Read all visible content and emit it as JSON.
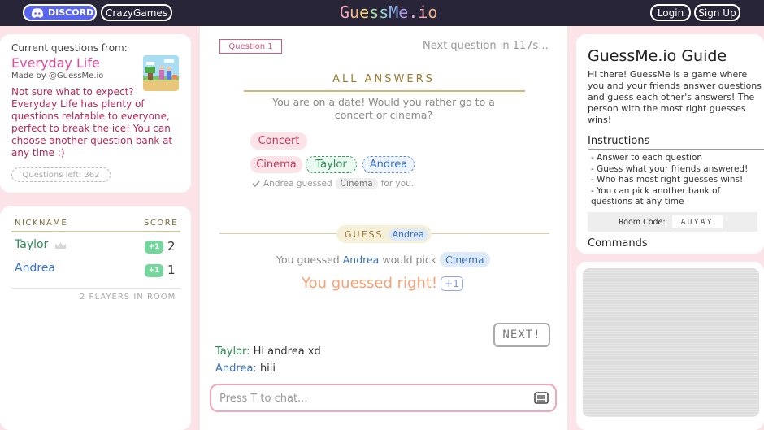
{
  "topbar": {
    "discord_label": "DISCORD",
    "crazy_label": "CrazyGames",
    "logo_letters": [
      "G",
      "u",
      "e",
      "s",
      "s",
      "M",
      "e",
      ".",
      "i",
      "o"
    ],
    "logo_colors": [
      "#f6a9b8",
      "#f3b48c",
      "#f7d57a",
      "#a7e0a3",
      "#8fd4d2",
      "#8fb3ef",
      "#b49cf0",
      "#e9a7e0",
      "#f6a9b8",
      "#f3b48c"
    ],
    "login_label": "Login",
    "signup_label": "Sign Up"
  },
  "current_questions": {
    "from_label": "Current questions from:",
    "name": "Everyday Life",
    "made_by": "Made by @GuessMe.io",
    "description": "Not sure what to expect? Everyday Life has plenty of questions relatable to everyone, perfect to break the ice! You can choose another question bank at any time :)",
    "questions_left": "Questions left: 362"
  },
  "players": {
    "nickname_header": "NICKNAME",
    "score_header": "SCORE",
    "list": [
      {
        "name": "Taylor",
        "badge": "+1",
        "score": "2",
        "color": "#2e8a55"
      },
      {
        "name": "Andrea",
        "badge": "+1",
        "score": "1",
        "color": "#3a6fc6"
      }
    ],
    "room_count": "2 PLAYERS IN ROOM"
  },
  "question": {
    "tag": "Question 1",
    "next_in": "Next question in 117s...",
    "all_answers_title": "ALL ANSWERS",
    "text": "You are on a date! Would you rather go to a concert or cinema?",
    "answers": {
      "concert": "Concert",
      "cinema": "Cinema",
      "taylor": "Taylor",
      "andrea": "Andrea"
    },
    "guessed_note": {
      "who": "Andrea guessed",
      "what": "Cinema",
      "suffix": "for you."
    }
  },
  "guess": {
    "label": "GUESS",
    "name": "Andrea",
    "pre": "You guessed",
    "who": "Andrea",
    "mid": "would pick",
    "pick": "Cinema",
    "result": "You guessed right!",
    "plus": "+1",
    "next_label": "NEXT!"
  },
  "chat": {
    "messages": [
      {
        "name": "Taylor:",
        "text": "Hi andrea xd",
        "color": "#2e8a55"
      },
      {
        "name": "Andrea:",
        "text": "hiii",
        "color": "#3a6fc6"
      }
    ],
    "placeholder": "Press T to chat..."
  },
  "guide": {
    "title": "GuessMe.io Guide",
    "intro": "Hi there! GuessMe is a game where you and your friends answer questions and guess each other's answers! The person with the most right guesses wins!",
    "instructions_title": "Instructions",
    "instructions": [
      "- Answer to each question",
      "- Guess what your friends answered!",
      "- Who has most right guesses wins!",
      "- You can pick another bank of questions at any time"
    ],
    "room_code_label": "Room Code:",
    "room_code": "AUYAY",
    "commands_title": "Commands"
  }
}
